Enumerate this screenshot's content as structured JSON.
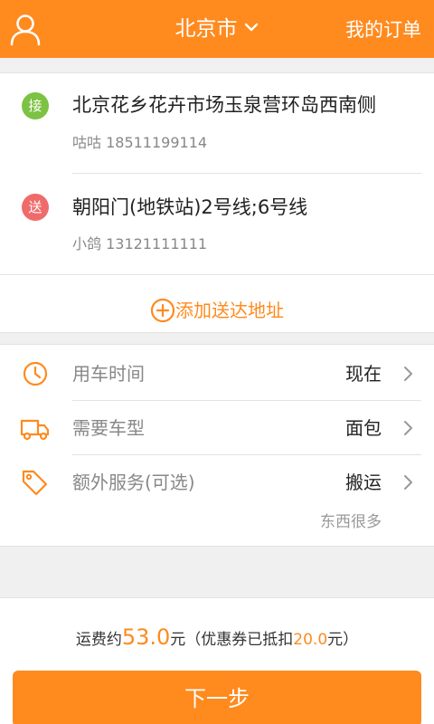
{
  "header": {
    "city": "北京市",
    "orders_label": "我的订单"
  },
  "addresses": {
    "pickup": {
      "badge": "接",
      "address": "北京花乡花卉市场玉泉营环岛西南侧",
      "contact": "咕咕 18511199114"
    },
    "dropoff": {
      "badge": "送",
      "address": "朝阳门(地铁站)2号线;6号线",
      "contact": "小鸽 13121111111"
    },
    "add_label": "添加送达地址"
  },
  "options": {
    "time": {
      "label": "用车时间",
      "value": "现在"
    },
    "vehicle": {
      "label": "需要车型",
      "value": "面包"
    },
    "service": {
      "label": "额外服务(可选)",
      "value": "搬运"
    },
    "note": "东西很多"
  },
  "fee": {
    "prefix": "运费约",
    "amount": "53.0",
    "unit": "元",
    "coupon_prefix": "（优惠券已抵扣",
    "coupon_amount": "20.0",
    "coupon_suffix": "元）"
  },
  "next_label": "下一步",
  "colors": {
    "accent": "#ff8a1e",
    "pickup_badge": "#7cc243",
    "dropoff_badge": "#ef6b6b"
  }
}
